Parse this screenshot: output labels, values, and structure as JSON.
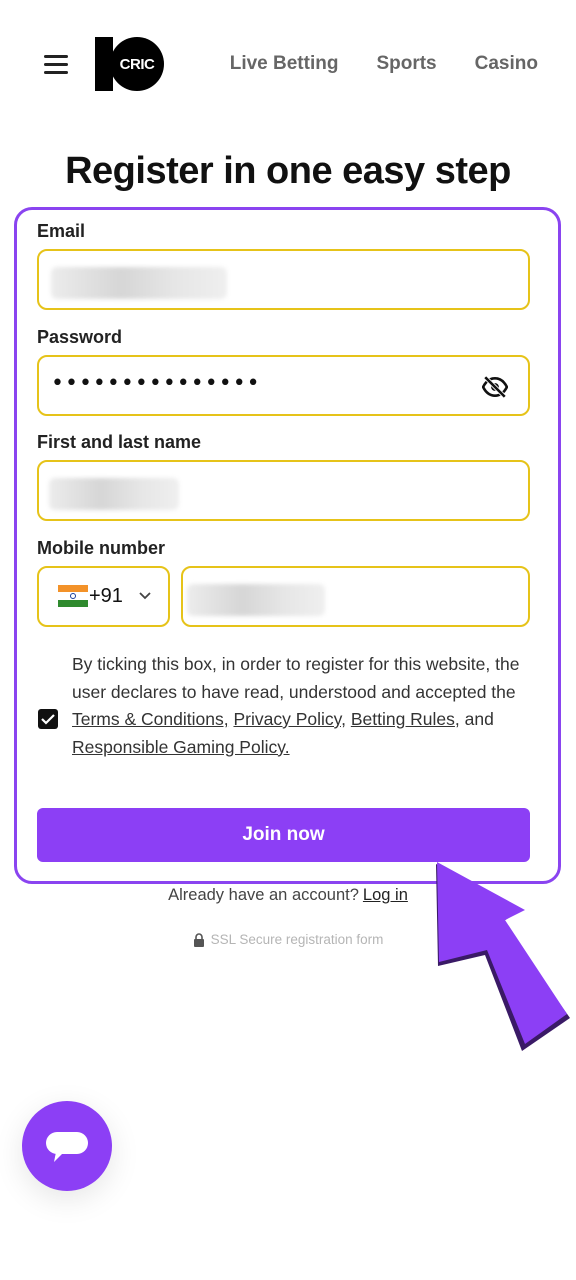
{
  "header": {
    "logo_text": "CRIC",
    "nav": [
      "Live Betting",
      "Sports",
      "Casino"
    ]
  },
  "page_title": "Register in one easy step",
  "form": {
    "email_label": "Email",
    "password_label": "Password",
    "password_masked": "•••••••••••••••",
    "name_label": "First and last name",
    "mobile_label": "Mobile number",
    "country_code": "+91",
    "consent_text_1": "By ticking this box, in order to register for this website, the user declares to have read, understood and accepted the",
    "terms_link": " Terms & Conditions,",
    "privacy_link": "Privacy Policy,",
    "betting_link": "Betting Rules",
    "consent_text_2": ", and",
    "responsible_link": "Responsible Gaming Policy.",
    "consent_checked": true,
    "submit_label": "Join now"
  },
  "already_account": {
    "text": "Already have an account?",
    "link": "Log in"
  },
  "ssl_text": "SSL Secure registration form",
  "colors": {
    "accent": "#8c3ff5",
    "field_border": "#e6c319",
    "card_border": "#8a44f0"
  },
  "icons": [
    "menu-icon",
    "eye-off-icon",
    "india-flag-icon",
    "chevron-down-icon",
    "check-icon",
    "lock-icon",
    "pointer-arrow-icon",
    "chat-icon"
  ]
}
